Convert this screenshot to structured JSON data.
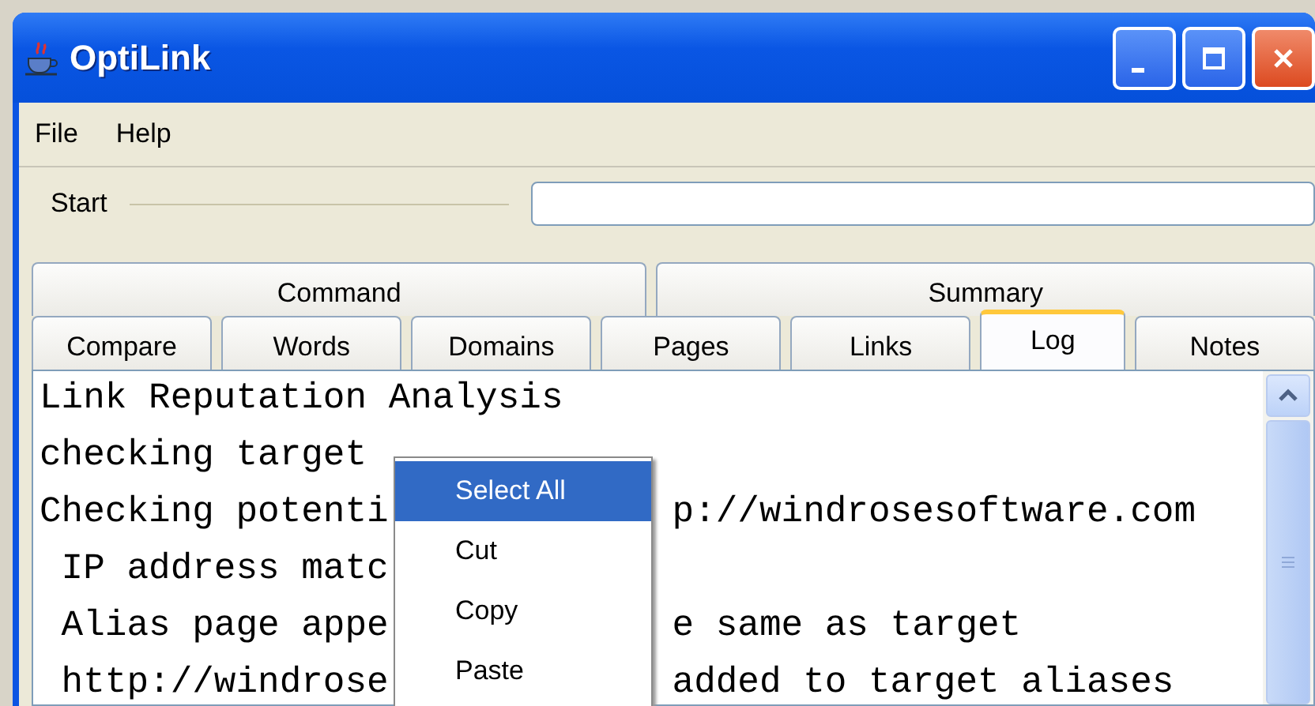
{
  "window": {
    "title": "OptiLink"
  },
  "menu": [
    "File",
    "Help"
  ],
  "start": {
    "label": "Start"
  },
  "tab_rows": [
    [
      {
        "label": "Command",
        "selected": false
      },
      {
        "label": "Summary",
        "selected": false
      }
    ],
    [
      {
        "label": "Compare",
        "selected": false
      },
      {
        "label": "Words",
        "selected": false
      },
      {
        "label": "Domains",
        "selected": false
      },
      {
        "label": "Pages",
        "selected": false
      },
      {
        "label": "Links",
        "selected": false
      },
      {
        "label": "Log",
        "selected": true
      },
      {
        "label": "Notes",
        "selected": false
      }
    ]
  ],
  "log_lines": [
    {
      "left": "Link Reputation Analysis"
    },
    {
      "left": "checking target"
    },
    {
      "left": "Checking potenti",
      "right": "p://windrosesoftware.com"
    },
    {
      "left": " IP address matc"
    },
    {
      "left": " Alias page appe",
      "right": "e same as target"
    },
    {
      "left": " http://windrose",
      "right": "added to target aliases"
    }
  ],
  "context_menu": [
    {
      "label": "Select All",
      "selected": true
    },
    {
      "label": "Cut",
      "selected": false
    },
    {
      "label": "Copy",
      "selected": false
    },
    {
      "label": "Paste",
      "selected": false
    }
  ]
}
